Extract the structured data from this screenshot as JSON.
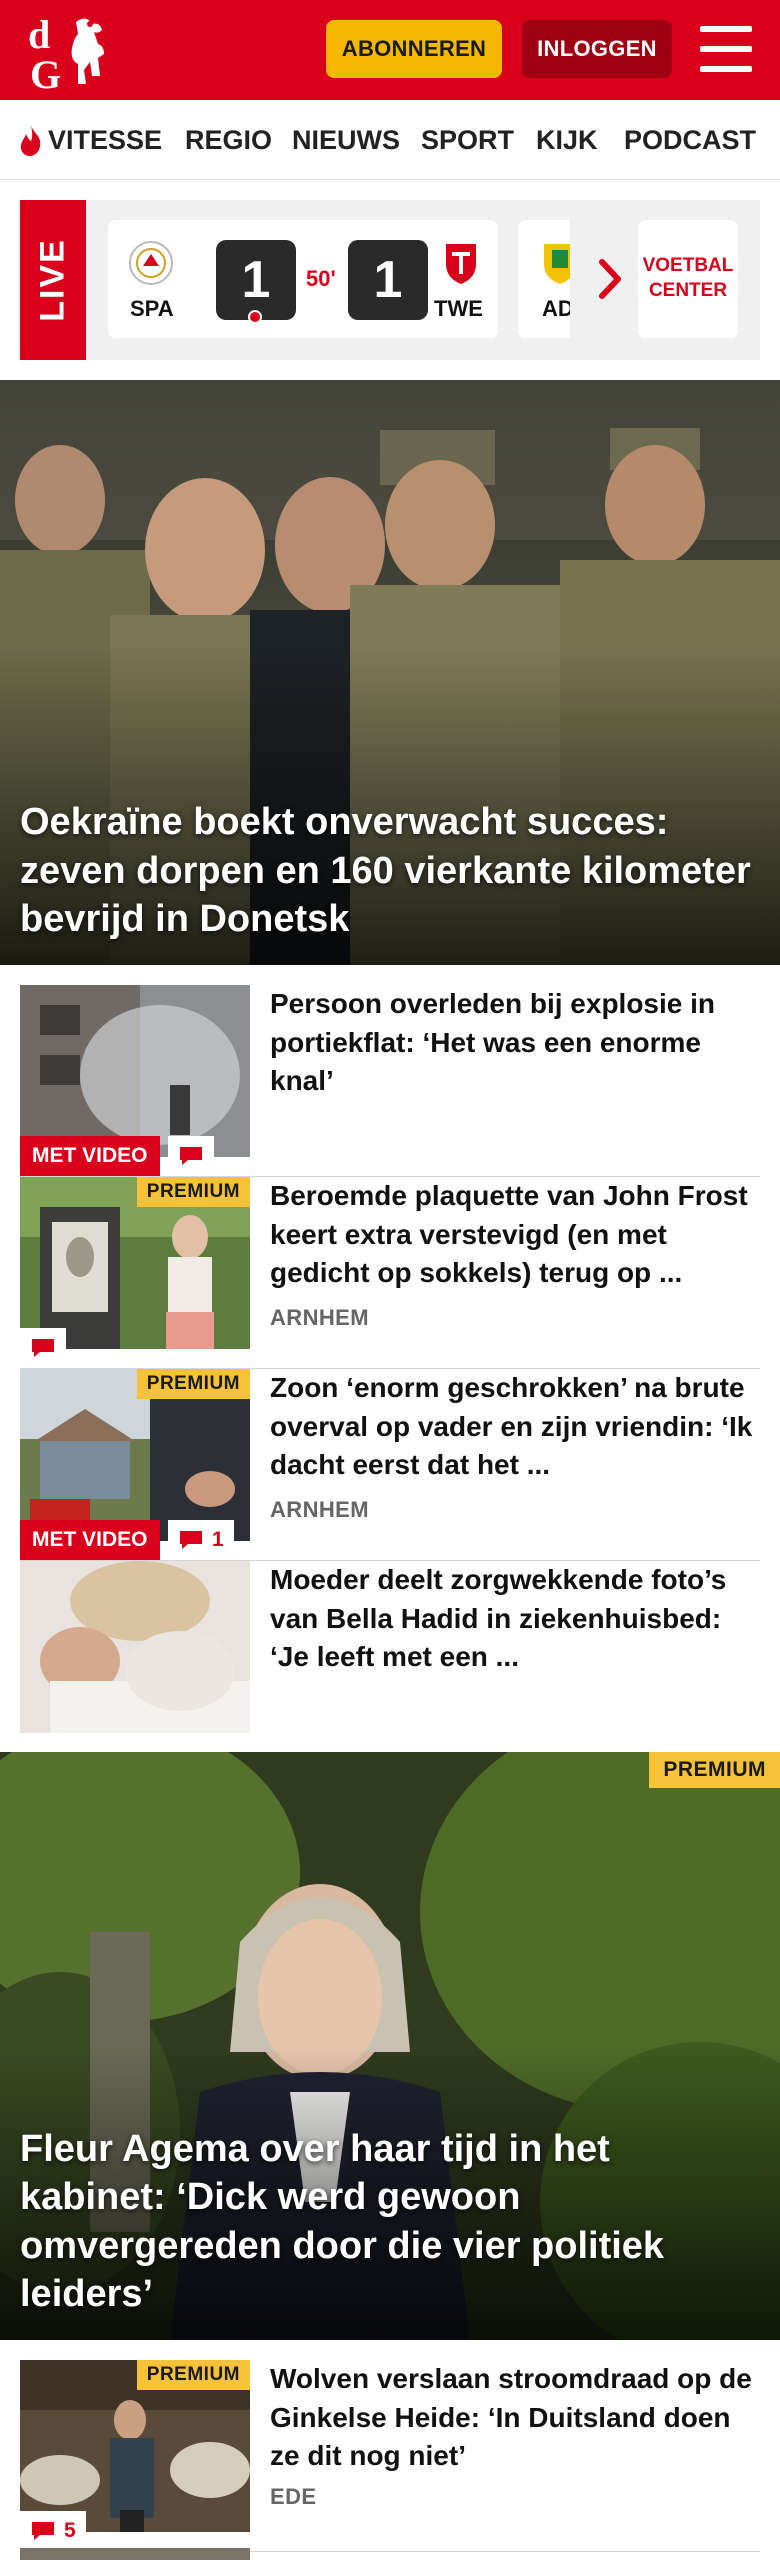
{
  "header": {
    "logo_text": "dG",
    "subscribe_label": "ABONNEREN",
    "login_label": "INLOGGEN",
    "brand_color": "#d9001b"
  },
  "nav": {
    "items": [
      {
        "label": "VITESSE",
        "icon": "flame-icon"
      },
      {
        "label": "REGIO"
      },
      {
        "label": "NIEUWS"
      },
      {
        "label": "SPORT"
      },
      {
        "label": "KIJK"
      },
      {
        "label": "PODCAST"
      }
    ]
  },
  "live": {
    "label": "LIVE",
    "match": {
      "home_code": "SPA",
      "home_score": "1",
      "minute": "50'",
      "away_code": "TWE",
      "away_score": "1"
    },
    "next_match_code": "AD",
    "voetbal_center_label": "VOETBAL CENTER"
  },
  "hero": {
    "title": "Oekraïne boekt onverwacht succes: zeven dorpen en 160 vierkante kilometer bevrijd in Donetsk"
  },
  "articles": [
    {
      "title": "Persoon overleden bij explosie in portiekflat: ‘Het was een enorme knal’",
      "section": "",
      "premium": false,
      "video_label": "MET VIDEO",
      "comments": ""
    },
    {
      "title": "Beroemde plaquette van John Frost keert extra verstevigd (en met gedicht op sokkels) terug op ...",
      "section": "ARNHEM",
      "premium": true,
      "premium_label": "PREMIUM",
      "video_label": "",
      "comments": ""
    },
    {
      "title": "Zoon ‘enorm geschrokken’ na brute overval op vader en zijn vriendin: ‘Ik dacht eerst dat het ...",
      "section": "ARNHEM",
      "premium": true,
      "premium_label": "PREMIUM",
      "video_label": "MET VIDEO",
      "comments": "1"
    },
    {
      "title": "Moeder deelt zorgwekkende foto’s van Bella Hadid in ziekenhuisbed: ‘Je leeft met een ...",
      "section": "",
      "premium": false,
      "video_label": "",
      "comments": ""
    }
  ],
  "feature": {
    "premium_label": "PREMIUM",
    "title": "Fleur Agema over haar tijd in het kabinet: ‘Dick werd gewoon omvergereden door die vier politiek leiders’"
  },
  "article_bottom": {
    "title": "Wolven verslaan stroomdraad op de Ginkelse Heide: ‘In Duitsland doen ze dit nog niet’",
    "section": "EDE",
    "premium_label": "PREMIUM",
    "comments": "5"
  }
}
